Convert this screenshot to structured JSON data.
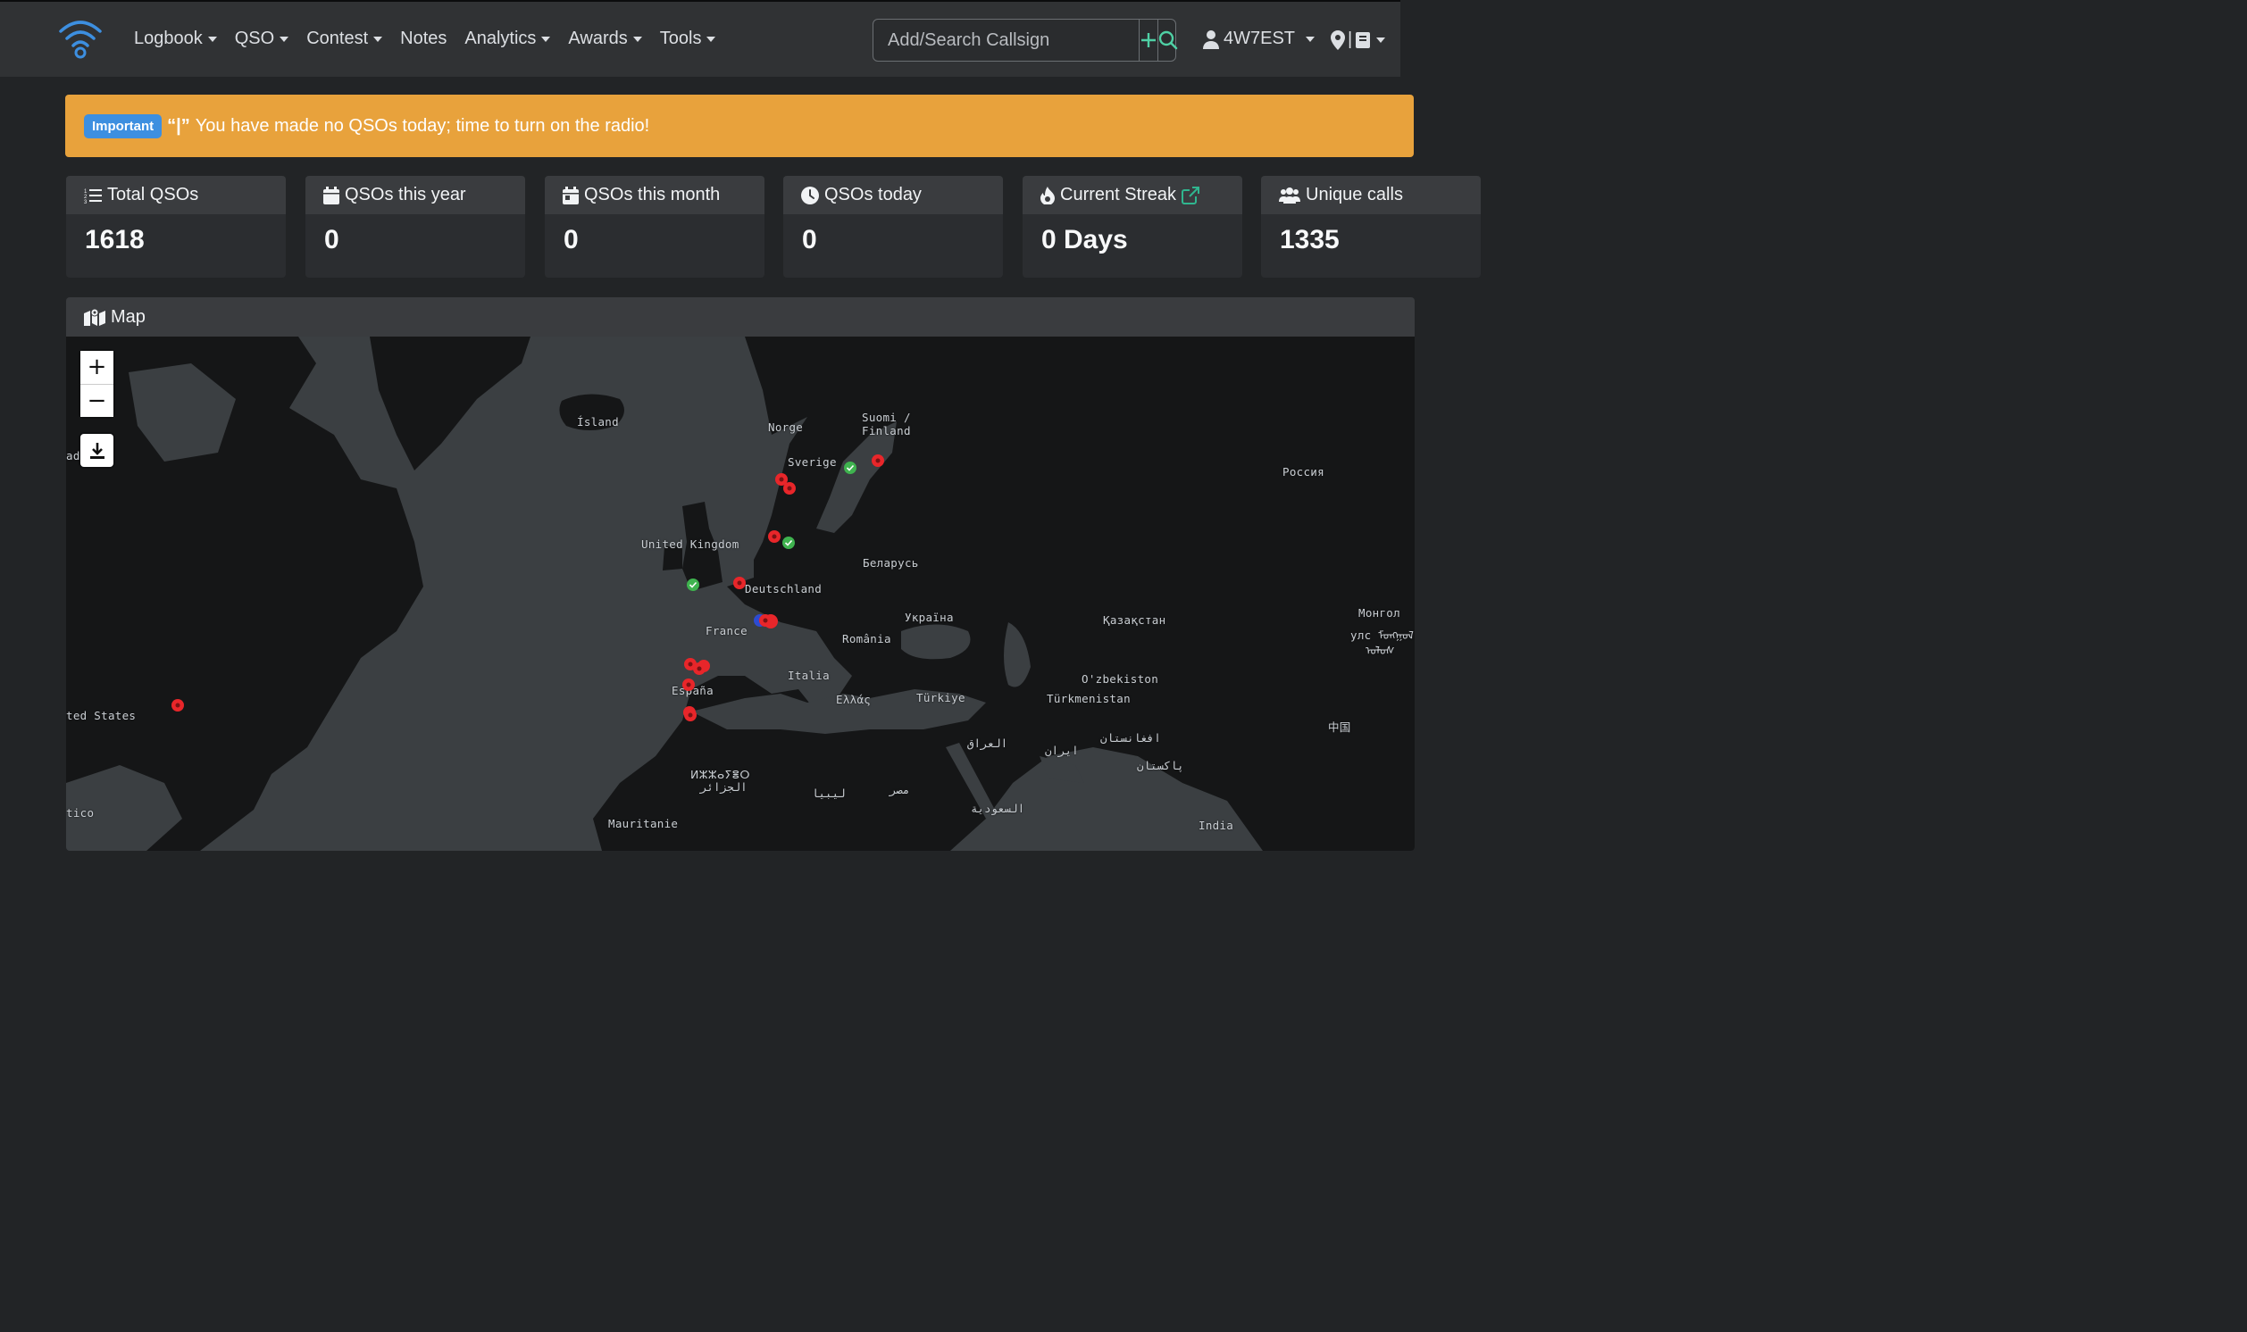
{
  "navbar": {
    "brand_icon": "wifi-signal-icon",
    "menu": [
      {
        "label": "Logbook",
        "dropdown": true
      },
      {
        "label": "QSO",
        "dropdown": true
      },
      {
        "label": "Contest",
        "dropdown": true
      },
      {
        "label": "Notes",
        "dropdown": false
      },
      {
        "label": "Analytics",
        "dropdown": true
      },
      {
        "label": "Awards",
        "dropdown": true
      },
      {
        "label": "Tools",
        "dropdown": true
      }
    ],
    "search": {
      "placeholder": "Add/Search Callsign",
      "value": ""
    },
    "user": {
      "callsign": "4W7EST"
    }
  },
  "alert": {
    "badge": "Important",
    "radio_glyph": "“|”",
    "message": "You have made no QSOs today; time to turn on the radio!",
    "color": "#e8a23c"
  },
  "stats": [
    {
      "label": "Total QSOs",
      "value": "1618",
      "icon": "list-ordered-icon"
    },
    {
      "label": "QSOs this year",
      "value": "0",
      "icon": "calendar-icon"
    },
    {
      "label": "QSOs this month",
      "value": "0",
      "icon": "calendar-day-icon"
    },
    {
      "label": "QSOs today",
      "value": "0",
      "icon": "clock-icon"
    },
    {
      "label": "Current Streak",
      "value": "0 Days",
      "icon": "fire-icon"
    },
    {
      "label": "Unique calls",
      "value": "1335",
      "icon": "users-icon"
    }
  ],
  "map": {
    "title": "Map",
    "zoom_in": "+",
    "zoom_out": "−",
    "labels": [
      "Ísland",
      "Norge",
      "Suomi /",
      "Finland",
      "Sverige",
      "Россия",
      "United Kingdom",
      "Беларусь",
      "Deutschland",
      "Україна",
      "Қазақстан",
      "France",
      "România",
      "Монгол",
      "улс ᠮᠤᠩᠭᠤᠯ",
      "ᠤᠯᠤᠰ",
      "Italia",
      "O'zbekiston",
      "España",
      "Ελλάς",
      "Türkiye",
      "Türkmenistan",
      "ted States",
      "中国",
      "العراق",
      "ایران",
      "افغانستان",
      "ⵍⵣⵣⴰⵢⴻⵔ",
      "الجزائر",
      "پاکستان",
      "ليبيا",
      "مصر",
      "السعودية",
      "tico",
      "Mauritanie",
      "India",
      "ad"
    ],
    "markers": {
      "confirmed_color": "#3fb34f",
      "unconfirmed_color": "#e8262a",
      "confirmed_count": 4,
      "unconfirmed_count": 14
    }
  }
}
